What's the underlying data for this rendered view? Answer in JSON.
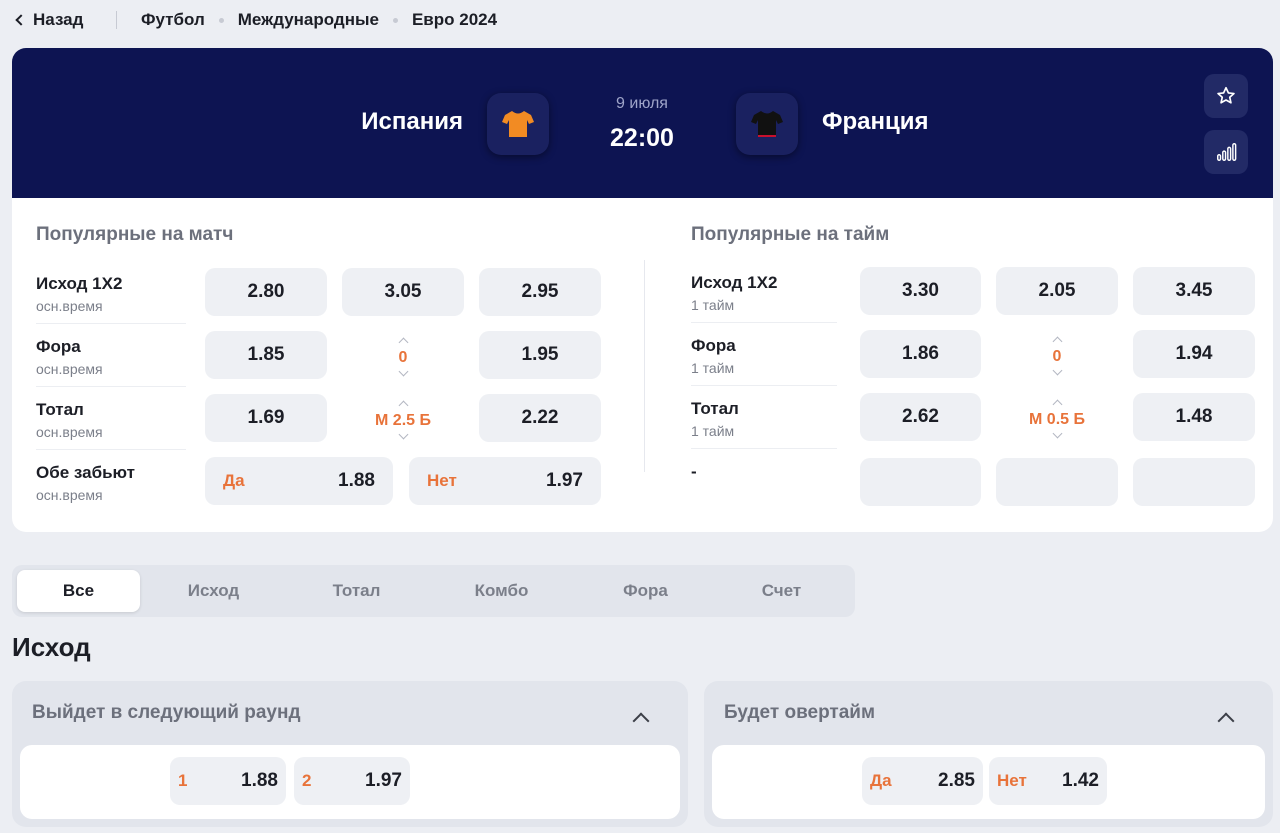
{
  "nav": {
    "back_label": "Назад",
    "breadcrumbs": [
      "Футбол",
      "Международные",
      "Евро 2024"
    ]
  },
  "match": {
    "team_home": "Испания",
    "team_away": "Франция",
    "date": "9 июля",
    "time": "22:00",
    "home_kit_color": "#f28b23",
    "away_kit_color": "#111111",
    "header_bg": "#0d1452"
  },
  "popular_match": {
    "title": "Популярные на матч",
    "markets": [
      {
        "name": "Исход 1X2",
        "sub": "осн.время",
        "odds": [
          "2.80",
          "3.05",
          "2.95"
        ]
      },
      {
        "name": "Фора",
        "sub": "осн.время",
        "odds": [
          "1.85",
          "1.95"
        ],
        "line": "0"
      },
      {
        "name": "Тотал",
        "sub": "осн.время",
        "odds": [
          "1.69",
          "2.22"
        ],
        "line": "М 2.5 Б"
      },
      {
        "name": "Обе забьют",
        "sub": "осн.время",
        "options": [
          {
            "label": "Да",
            "odd": "1.88"
          },
          {
            "label": "Нет",
            "odd": "1.97"
          }
        ]
      }
    ]
  },
  "popular_half": {
    "title": "Популярные на тайм",
    "markets": [
      {
        "name": "Исход 1X2",
        "sub": "1 тайм",
        "odds": [
          "3.30",
          "2.05",
          "3.45"
        ]
      },
      {
        "name": "Фора",
        "sub": "1 тайм",
        "odds": [
          "1.86",
          "1.94"
        ],
        "line": "0"
      },
      {
        "name": "Тотал",
        "sub": "1 тайм",
        "odds": [
          "2.62",
          "1.48"
        ],
        "line": "М 0.5 Б"
      },
      {
        "name": "-"
      }
    ]
  },
  "tabs": [
    "Все",
    "Исход",
    "Тотал",
    "Комбо",
    "Фора",
    "Счет"
  ],
  "active_tab": "Все",
  "section_title": "Исход",
  "cards": [
    {
      "title": "Выйдет в следующий раунд",
      "options": [
        {
          "label": "1",
          "odd": "1.88"
        },
        {
          "label": "2",
          "odd": "1.97"
        }
      ]
    },
    {
      "title": "Будет овертайм",
      "options": [
        {
          "label": "Да",
          "odd": "2.85"
        },
        {
          "label": "Нет",
          "odd": "1.42"
        }
      ]
    }
  ],
  "colors": {
    "accent": "#e8733a",
    "page_bg": "#eceef3",
    "odd_bg": "#eef0f4"
  }
}
